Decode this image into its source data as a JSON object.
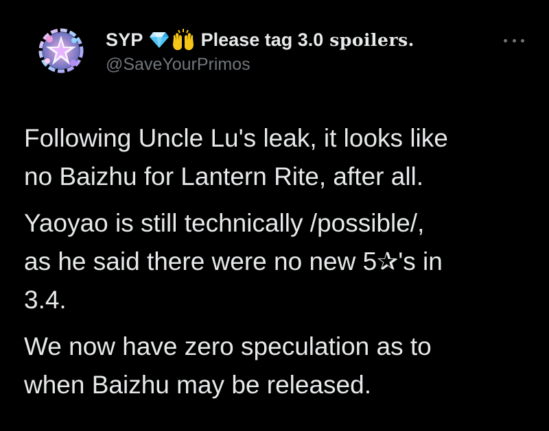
{
  "author": {
    "display_name": "SYP",
    "name_suffix": "Please tag 3.0",
    "name_fancy": "𝐬𝐩𝐨𝐢𝐥𝐞𝐫𝐬.",
    "handle": "@SaveYourPrimos",
    "emojis": [
      "gem-emoji",
      "raising-hands-emoji"
    ]
  },
  "more_button": {
    "icon": "more-dots-icon"
  },
  "tweet": {
    "paragraphs": [
      "Following Uncle Lu's leak, it looks like\nno Baizhu for Lantern Rite, after all.",
      "Yaoyao is still technically /possible/,\nas he said there were no new 5✰'s in\n3.4.",
      "We now have zero speculation as to\nwhen Baizhu may be released."
    ]
  },
  "colors": {
    "background": "#000000",
    "text_primary": "#e7e9ea",
    "text_secondary": "#71767b",
    "gem": "#4fc3f7",
    "hands": "#f5c518"
  }
}
